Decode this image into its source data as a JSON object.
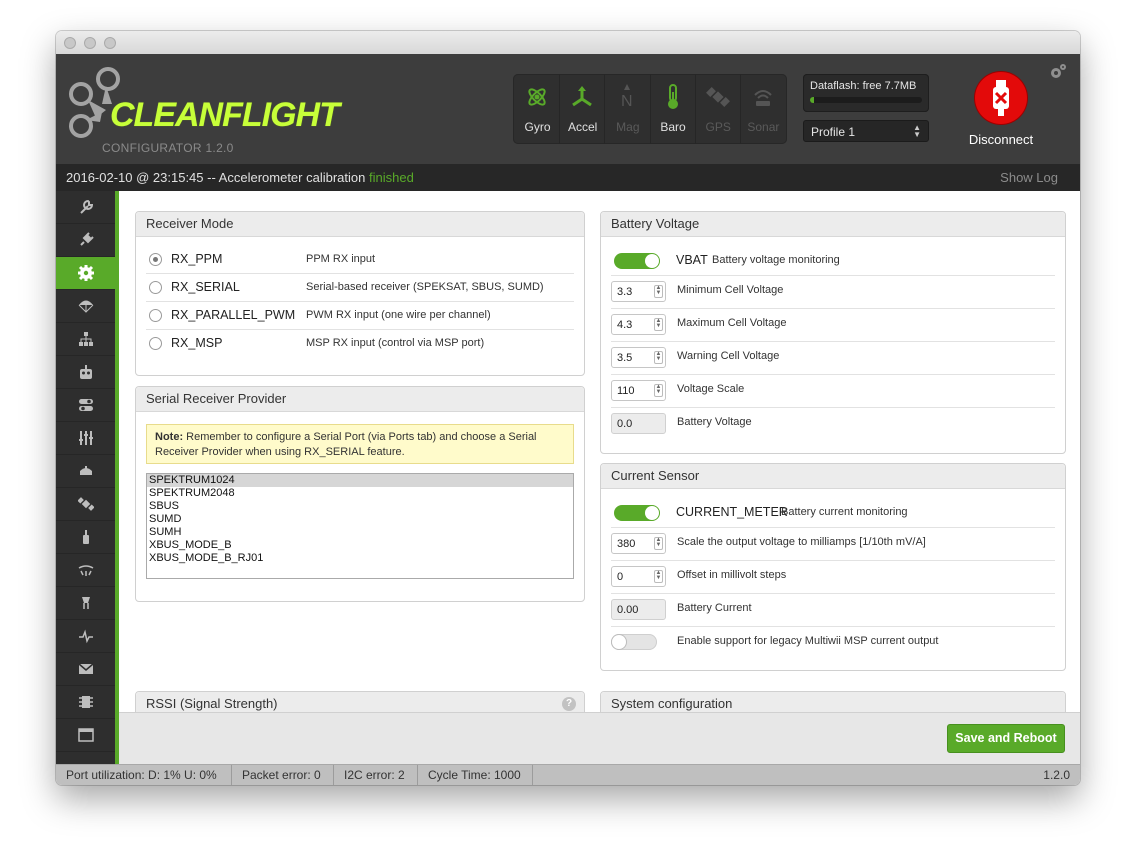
{
  "app": {
    "logo_text": "CLEANFLIGHT",
    "subtitle": "CONFIGURATOR  1.2.0"
  },
  "sensors": [
    {
      "label": "Gyro",
      "icon": "gyro-icon",
      "active": true
    },
    {
      "label": "Accel",
      "icon": "accel-icon",
      "active": true
    },
    {
      "label": "Mag",
      "icon": "mag-icon",
      "active": false
    },
    {
      "label": "Baro",
      "icon": "baro-icon",
      "active": true
    },
    {
      "label": "GPS",
      "icon": "gps-icon",
      "active": false
    },
    {
      "label": "Sonar",
      "icon": "sonar-icon",
      "active": false
    }
  ],
  "dataflash": {
    "label": "Dataflash: free 7.7MB",
    "used_fraction": 0.04
  },
  "profile": {
    "selected": "Profile 1"
  },
  "disconnect": {
    "label": "Disconnect"
  },
  "status": {
    "message": "2016-02-10 @ 23:15:45 -- Accelerometer calibration",
    "result": "finished",
    "show_log": "Show Log"
  },
  "sidebar": {
    "items": [
      {
        "icon": "wrench-icon"
      },
      {
        "icon": "plug-icon"
      },
      {
        "icon": "gear-icon",
        "active": true
      },
      {
        "icon": "parachute-icon"
      },
      {
        "icon": "network-icon"
      },
      {
        "icon": "robot-icon"
      },
      {
        "icon": "toggles-icon"
      },
      {
        "icon": "sliders-icon"
      },
      {
        "icon": "led-icon"
      },
      {
        "icon": "satellite-icon"
      },
      {
        "icon": "motor-icon"
      },
      {
        "icon": "servo-icon"
      },
      {
        "icon": "led-strip-icon"
      },
      {
        "icon": "pulse-icon"
      },
      {
        "icon": "logbook-icon"
      },
      {
        "icon": "chip-icon"
      },
      {
        "icon": "cli-icon"
      }
    ]
  },
  "receiver_mode": {
    "title": "Receiver Mode",
    "options": [
      {
        "name": "RX_PPM",
        "desc": "PPM RX input",
        "checked": true
      },
      {
        "name": "RX_SERIAL",
        "desc": "Serial-based receiver (SPEKSAT, SBUS, SUMD)",
        "checked": false
      },
      {
        "name": "RX_PARALLEL_PWM",
        "desc": "PWM RX input (one wire per channel)",
        "checked": false
      },
      {
        "name": "RX_MSP",
        "desc": "MSP RX input (control via MSP port)",
        "checked": false
      }
    ]
  },
  "serial_provider": {
    "title": "Serial Receiver Provider",
    "note_bold": "Note:",
    "note_text": " Remember to configure a Serial Port (via Ports tab) and choose a Serial Receiver Provider when using RX_SERIAL feature.",
    "items": [
      "SPEKTRUM1024",
      "SPEKTRUM2048",
      "SBUS",
      "SUMD",
      "SUMH",
      "XBUS_MODE_B",
      "XBUS_MODE_B_RJ01"
    ],
    "selected": "SPEKTRUM1024"
  },
  "rssi": {
    "title": "RSSI (Signal Strength)",
    "help": "?"
  },
  "battery": {
    "title": "Battery Voltage",
    "toggle_name": "VBAT",
    "toggle_desc": "Battery voltage monitoring",
    "fields": [
      {
        "value": "3.3",
        "label": "Minimum Cell Voltage"
      },
      {
        "value": "4.3",
        "label": "Maximum Cell Voltage"
      },
      {
        "value": "3.5",
        "label": "Warning Cell Voltage"
      },
      {
        "value": "110",
        "label": "Voltage Scale"
      }
    ],
    "readout": {
      "value": "0.0",
      "label": "Battery Voltage"
    }
  },
  "current": {
    "title": "Current Sensor",
    "toggle_name": "CURRENT_METER",
    "toggle_desc": "Battery current monitoring",
    "fields": [
      {
        "value": "380",
        "label": "Scale the output voltage to milliamps [1/10th mV/A]"
      },
      {
        "value": "0",
        "label": "Offset in millivolt steps"
      }
    ],
    "readout": {
      "value": "0.00",
      "label": "Battery Current"
    },
    "legacy_label": "Enable support for legacy Multiwii MSP current output"
  },
  "system": {
    "title": "System configuration"
  },
  "save_button": "Save and Reboot",
  "footer": {
    "port_util": "Port utilization: D: 1% U: 0%",
    "packet_error": "Packet error: 0",
    "i2c_error": "I2C error: 2",
    "cycle_time": "Cycle Time: 1000",
    "version": "1.2.0"
  },
  "colors": {
    "accent": "#59aa29",
    "disconnect": "#e30a0a"
  }
}
